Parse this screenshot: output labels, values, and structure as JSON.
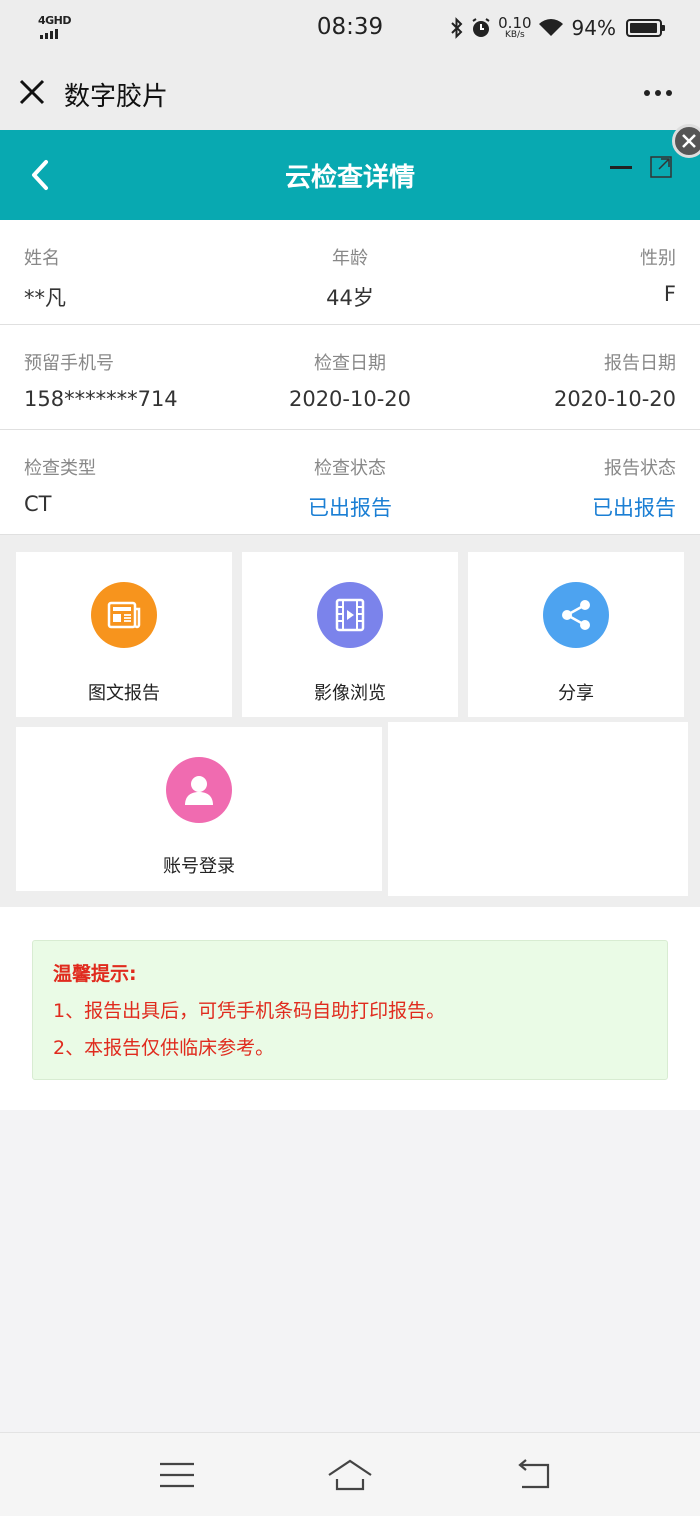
{
  "status_bar": {
    "network": "4GHD",
    "time": "08:39",
    "speed_value": "0.10",
    "speed_unit": "KB/s",
    "battery": "94%"
  },
  "wechat_nav": {
    "title": "数字胶片"
  },
  "app_header": {
    "title": "云检查详情"
  },
  "info": {
    "rows": [
      [
        {
          "label": "姓名",
          "value": "**凡"
        },
        {
          "label": "年龄",
          "value": "44岁"
        },
        {
          "label": "性别",
          "value": "F"
        }
      ],
      [
        {
          "label": "预留手机号",
          "value": "158*******714"
        },
        {
          "label": "检查日期",
          "value": "2020-10-20"
        },
        {
          "label": "报告日期",
          "value": "2020-10-20"
        }
      ],
      [
        {
          "label": "检查类型",
          "value": "CT"
        },
        {
          "label": "检查状态",
          "value": "已出报告"
        },
        {
          "label": "报告状态",
          "value": "已出报告"
        }
      ]
    ]
  },
  "tiles": [
    {
      "label": "图文报告",
      "icon": "newspaper-icon",
      "color": "#f7941d"
    },
    {
      "label": "影像浏览",
      "icon": "film-icon",
      "color": "#7b83eb"
    },
    {
      "label": "分享",
      "icon": "share-icon",
      "color": "#4da3f0"
    },
    {
      "label": "账号登录",
      "icon": "user-icon",
      "color": "#f06bb0"
    }
  ],
  "tips": {
    "title": "温馨提示:",
    "lines": [
      "1、报告出具后，可凭手机条码自助打印报告。",
      "2、本报告仅供临床参考。"
    ]
  },
  "colors": {
    "header_bg": "#08a9b1",
    "link_blue": "#1b7fd4",
    "tip_red": "#e02b1e",
    "tip_bg": "#eafbe6"
  }
}
